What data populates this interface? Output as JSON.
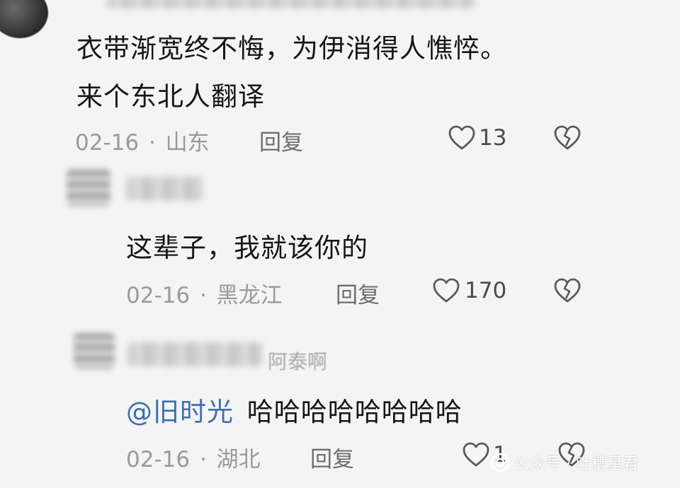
{
  "comments": [
    {
      "text_line1": "衣带渐宽终不悔，为伊消得人憔悴。",
      "text_line2": "来个东北人翻译",
      "date": "02-16",
      "sep": "·",
      "location": "山东",
      "reply_label": "回复",
      "likes": "13"
    },
    {
      "text": "这辈子，我就该你的",
      "date": "02-16",
      "sep": "·",
      "location": "黑龙江",
      "reply_label": "回复",
      "likes": "170"
    },
    {
      "visible_name": "阿泰啊",
      "mention": "@旧时光",
      "text": "哈哈哈哈哈哈哈哈",
      "date": "02-16",
      "sep": "·",
      "location": "湖北",
      "reply_label": "回复",
      "likes": "1"
    }
  ],
  "watermark": {
    "text": "公众号 · 吐槽星君",
    "icon": "wechat-public-account-icon"
  },
  "icons": {
    "like": "heart-outline-icon",
    "dislike": "broken-heart-icon"
  },
  "colors": {
    "background": "#f4f4f4",
    "text": "#161616",
    "meta": "#9a9a9a",
    "mention": "#3f6fae"
  }
}
